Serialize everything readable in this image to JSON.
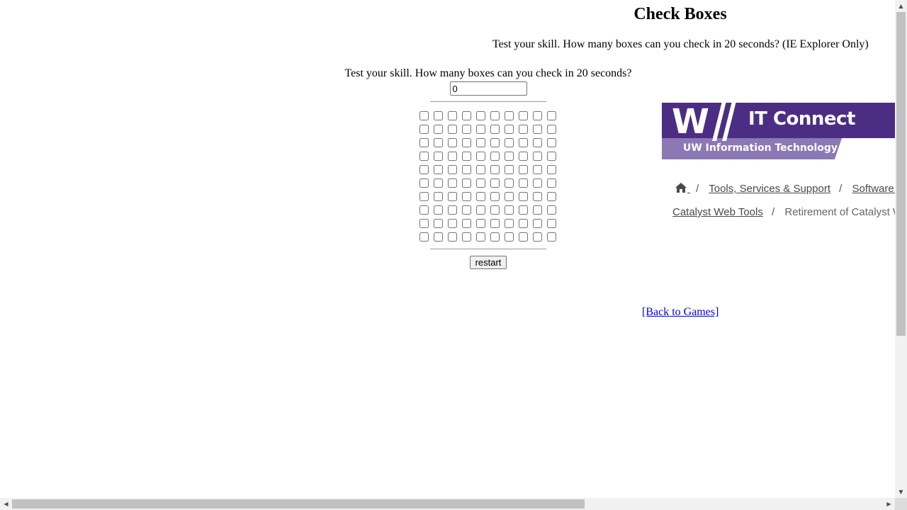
{
  "page": {
    "title": "Check Boxes",
    "subtitle": "Test your skill. How many boxes can you check in 20 seconds? (IE Explorer Only)"
  },
  "game": {
    "prompt": "Test your skill. How many boxes can you check in 20 seconds?",
    "count_value": "0",
    "rows": 10,
    "columns": 10,
    "restart_label": "restart"
  },
  "back_link": {
    "label": "[Back to Games]"
  },
  "uw_header": {
    "logo_letter": "W",
    "site_title": "IT Connect",
    "site_subtitle": "UW Information Technology",
    "brand_color": "#4b2e83",
    "subbar_color": "#8b78b4"
  },
  "breadcrumb": {
    "home_icon": "home-icon",
    "items": [
      {
        "label": "Tools, Services & Support"
      },
      {
        "label": "Software & Computing"
      },
      {
        "label": "Catalyst Web Tools"
      },
      {
        "label": "Retirement of Catalyst WebQ"
      }
    ]
  },
  "scrollbars": {
    "up_arrow": "▲",
    "down_arrow": "▼",
    "left_arrow": "◀",
    "right_arrow": "▶"
  }
}
